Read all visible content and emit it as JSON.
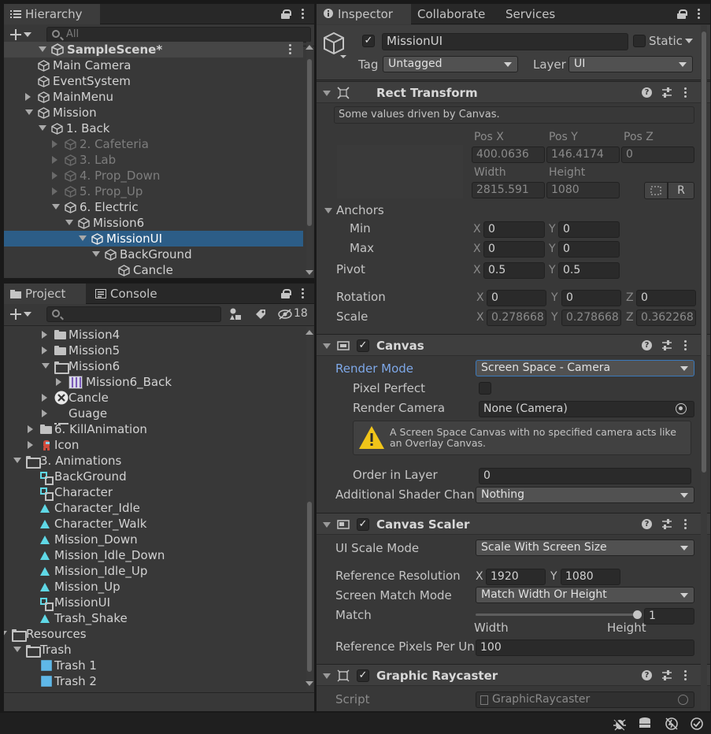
{
  "hierarchy": {
    "tab": "Hierarchy",
    "search_placeholder": "All",
    "scene": "SampleScene*",
    "items": [
      {
        "label": "Main Camera"
      },
      {
        "label": "EventSystem"
      },
      {
        "label": "MainMenu"
      },
      {
        "label": "Mission"
      },
      {
        "label": "1. Back"
      },
      {
        "label": "2. Cafeteria"
      },
      {
        "label": "3. Lab"
      },
      {
        "label": "4. Prop_Down"
      },
      {
        "label": "5. Prop_Up"
      },
      {
        "label": "6. Electric"
      },
      {
        "label": "Mission6"
      },
      {
        "label": "MissionUI"
      },
      {
        "label": "BackGround"
      },
      {
        "label": "Cancle"
      }
    ]
  },
  "project": {
    "tab_project": "Project",
    "tab_console": "Console",
    "hidden_count": "18",
    "items": [
      {
        "label": "Mission4"
      },
      {
        "label": "Mission5"
      },
      {
        "label": "Mission6"
      },
      {
        "label": "Mission6_Back"
      },
      {
        "label": "Cancle"
      },
      {
        "label": "Guage"
      },
      {
        "label": "6. KillAnimation"
      },
      {
        "label": "Icon"
      },
      {
        "label": "3. Animations"
      },
      {
        "label": "BackGround"
      },
      {
        "label": "Character"
      },
      {
        "label": "Character_Idle"
      },
      {
        "label": "Character_Walk"
      },
      {
        "label": "Mission_Down"
      },
      {
        "label": "Mission_Idle_Down"
      },
      {
        "label": "Mission_Idle_Up"
      },
      {
        "label": "Mission_Up"
      },
      {
        "label": "MissionUI"
      },
      {
        "label": "Trash_Shake"
      },
      {
        "label": "Resources"
      },
      {
        "label": "Trash"
      },
      {
        "label": "Trash 1"
      },
      {
        "label": "Trash 2"
      }
    ]
  },
  "inspector": {
    "tabs": [
      "Inspector",
      "Collaborate",
      "Services"
    ],
    "object_name": "MissionUI",
    "static_label": "Static",
    "tag_label": "Tag",
    "tag_value": "Untagged",
    "layer_label": "Layer",
    "layer_value": "UI",
    "rect_transform": {
      "title": "Rect Transform",
      "note": "Some values driven by Canvas.",
      "posx_label": "Pos X",
      "posy_label": "Pos Y",
      "posz_label": "Pos Z",
      "posx": "400.0636",
      "posy": "146.4174",
      "posz": "0",
      "width_label": "Width",
      "height_label": "Height",
      "width": "2815.591",
      "height": "1080",
      "r_btn": "R",
      "anchors_label": "Anchors",
      "min_label": "Min",
      "max_label": "Max",
      "min_x": "0",
      "min_y": "0",
      "max_x": "0",
      "max_y": "0",
      "pivot_label": "Pivot",
      "pivot_x": "0.5",
      "pivot_y": "0.5",
      "rotation_label": "Rotation",
      "rot_x": "0",
      "rot_y": "0",
      "rot_z": "0",
      "scale_label": "Scale",
      "scale_x": "0.278668",
      "scale_y": "0.278668",
      "scale_z": "0.362268",
      "x": "X",
      "y": "Y",
      "z": "Z"
    },
    "canvas": {
      "title": "Canvas",
      "render_mode_label": "Render Mode",
      "render_mode": "Screen Space - Camera",
      "pixel_perfect_label": "Pixel Perfect",
      "render_camera_label": "Render Camera",
      "render_camera": "None (Camera)",
      "warning": "A Screen Space Canvas with no specified camera acts like an Overlay Canvas.",
      "order_label": "Order in Layer",
      "order": "0",
      "shader_label": "Additional Shader Chanr",
      "shader": "Nothing"
    },
    "scaler": {
      "title": "Canvas Scaler",
      "mode_label": "UI Scale Mode",
      "mode": "Scale With Screen Size",
      "ref_label": "Reference Resolution",
      "ref_x": "1920",
      "ref_y": "1080",
      "match_mode_label": "Screen Match Mode",
      "match_mode": "Match Width Or Height",
      "match_label": "Match",
      "match_value": "1",
      "match_fraction": 1.0,
      "width_end": "Width",
      "height_end": "Height",
      "ppu_label": "Reference Pixels Per Un",
      "ppu": "100"
    },
    "raycaster": {
      "title": "Graphic Raycaster",
      "script_label": "Script",
      "script": "GraphicRaycaster"
    }
  },
  "colors": {
    "selection": "#2c5d87",
    "link_label": "#7ea8e8",
    "anim_icon": "#5fd8e6"
  }
}
